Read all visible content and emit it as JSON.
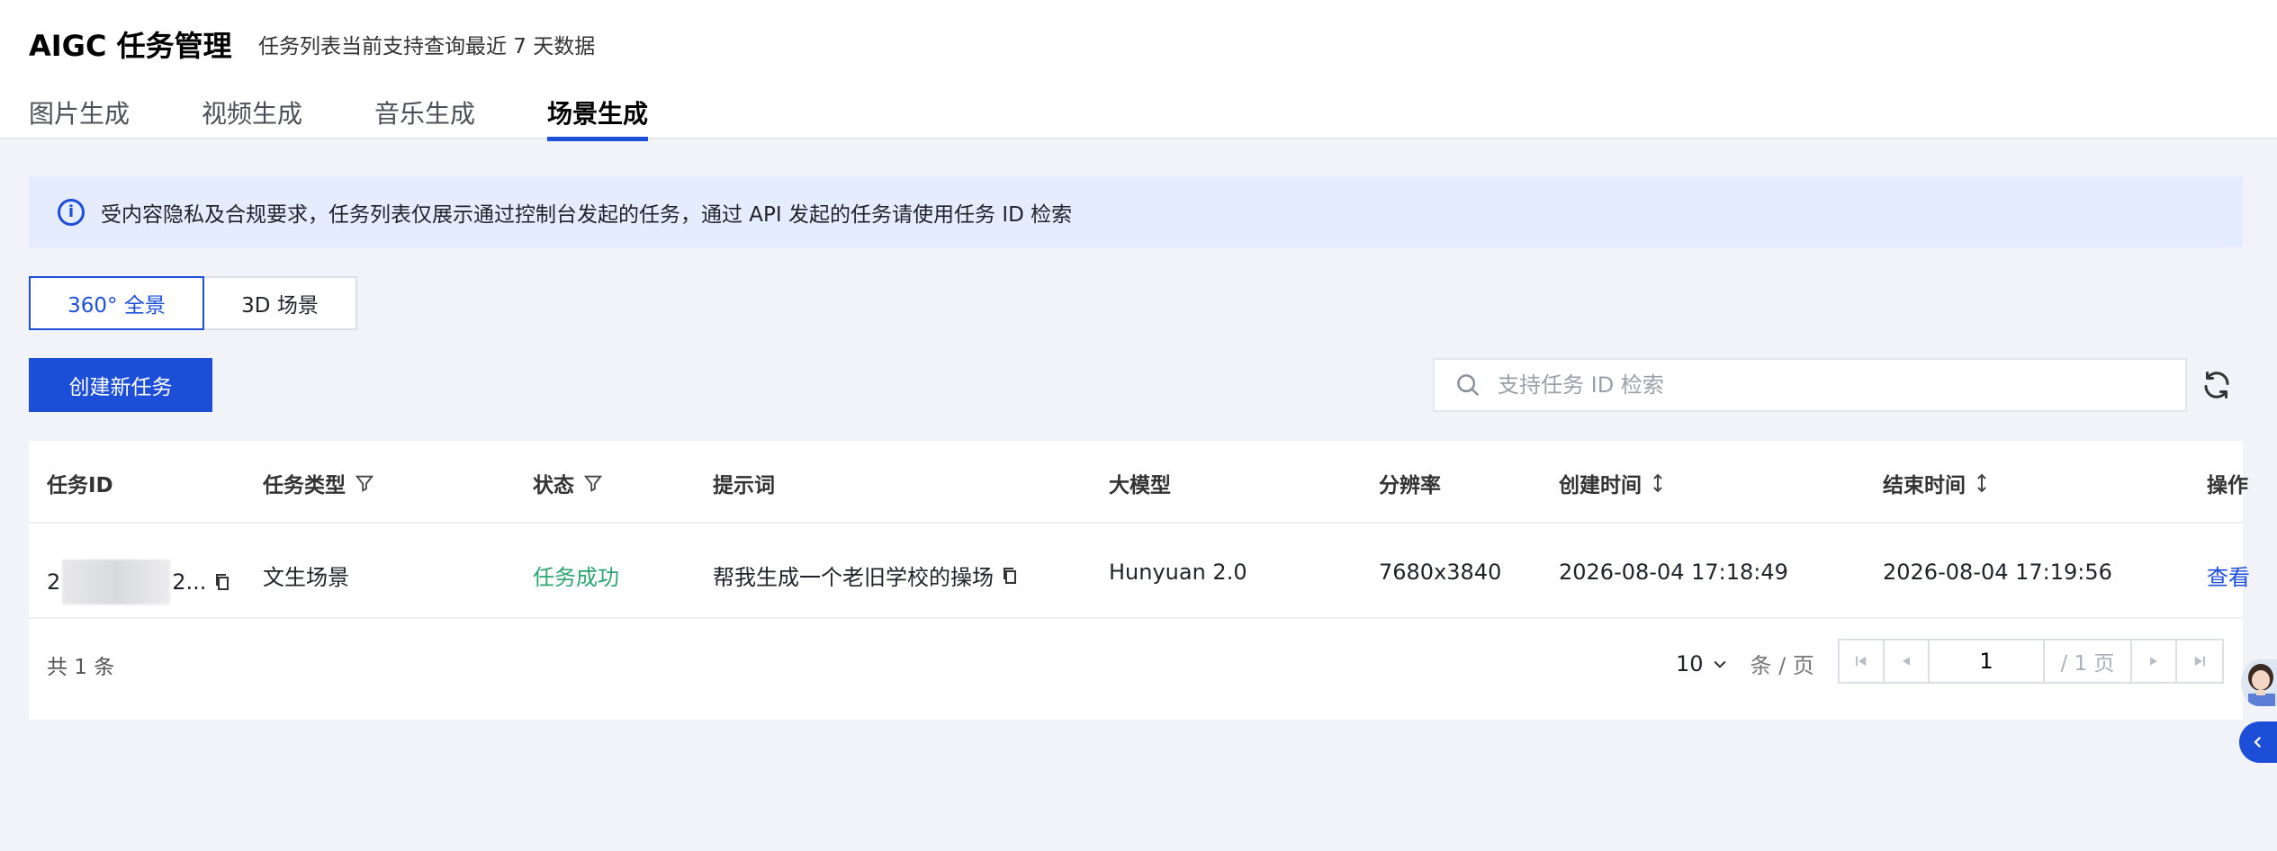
{
  "header": {
    "title": "AIGC 任务管理",
    "subtitle": "任务列表当前支持查询最近 7 天数据",
    "tabs": [
      {
        "label": "图片生成",
        "active": false
      },
      {
        "label": "视频生成",
        "active": false
      },
      {
        "label": "音乐生成",
        "active": false
      },
      {
        "label": "场景生成",
        "active": true
      }
    ]
  },
  "notice": {
    "icon": "info-icon",
    "text": "受内容隐私及合规要求，任务列表仅展示通过控制台发起的任务，通过 API 发起的任务请使用任务 ID 检索"
  },
  "segment": {
    "options": [
      "360° 全景",
      "3D 场景"
    ],
    "selected": "360° 全景"
  },
  "toolbar": {
    "create_label": "创建新任务",
    "search_placeholder": "支持任务 ID 检索",
    "search_value": ""
  },
  "table": {
    "columns": [
      "任务ID",
      "任务类型",
      "状态",
      "提示词",
      "大模型",
      "分辨率",
      "创建时间",
      "结束时间",
      "操作"
    ],
    "rows": [
      {
        "id_prefix": "2",
        "id_suffix": "2...",
        "type": "文生场景",
        "status": "任务成功",
        "prompt": "帮我生成一个老旧学校的操场",
        "model": "Hunyuan 2.0",
        "resolution": "7680x3840",
        "created": "2026-08-04 17:18:49",
        "ended": "2026-08-04 17:19:56",
        "action": "查看"
      }
    ]
  },
  "pagination": {
    "total": "共 1 条",
    "page_size": "10",
    "page_size_unit": "条 / 页",
    "current_page": "1",
    "total_pages": "/ 1 页"
  },
  "colors": {
    "accent": "#1d4ed8",
    "success": "#2ba471",
    "notice_bg": "#e4ecfd",
    "page_bg": "#f2f3f8"
  }
}
